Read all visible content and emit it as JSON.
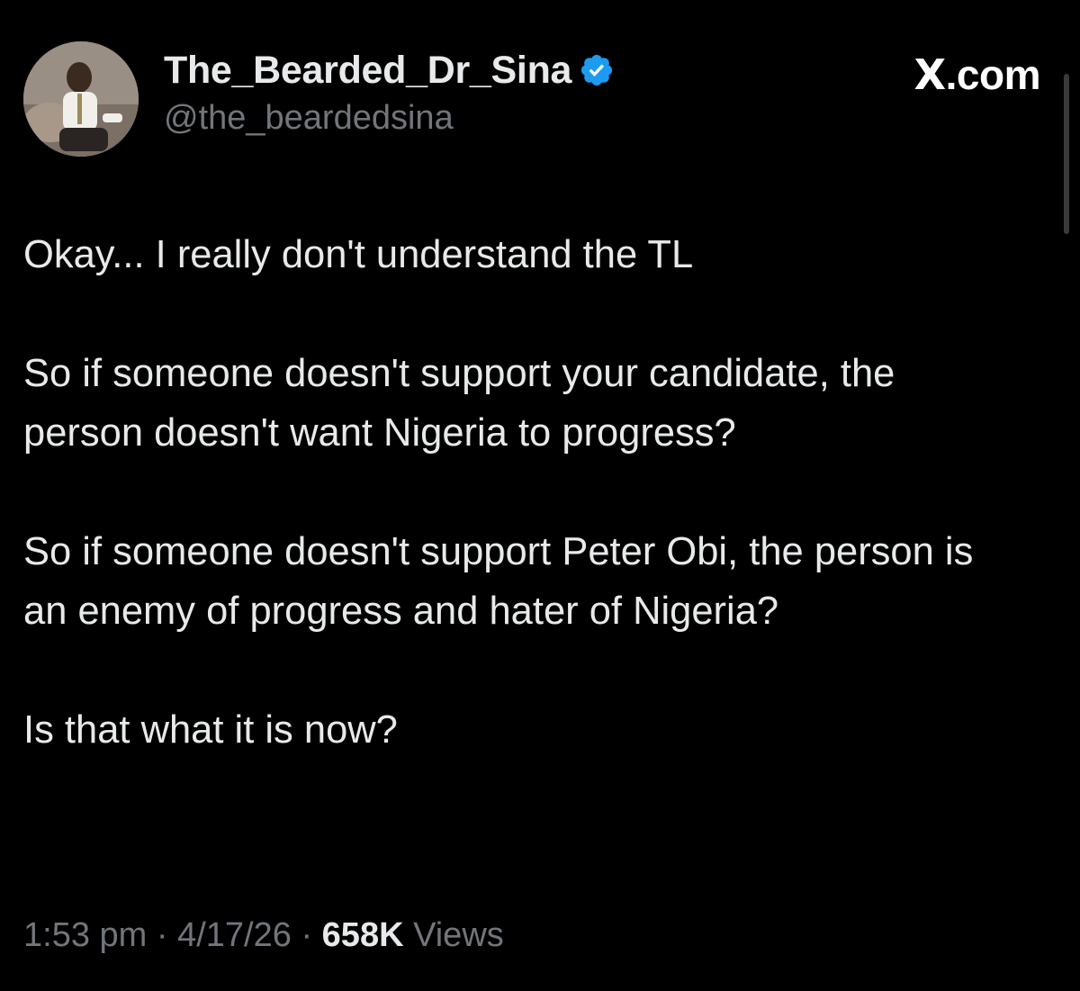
{
  "author": {
    "display_name": "The_Bearded_Dr_Sina",
    "handle": "@the_beardedsina",
    "verified_icon": "verified-badge-icon",
    "verified_color": "#1d9bf0"
  },
  "brand": {
    "label": ".com",
    "logo": "X"
  },
  "tweet": {
    "paragraphs": [
      "Okay... I really don't understand the TL",
      "So if someone doesn't support your candidate, the person doesn't want Nigeria to progress?",
      "So if someone doesn't support Peter Obi, the person is an enemy of progress and hater of Nigeria?",
      "Is that what it is now?"
    ]
  },
  "meta": {
    "time": "1:53 pm",
    "date": "4/17/26",
    "separator": "·",
    "views_count": "658K",
    "views_label": "Views"
  },
  "colors": {
    "background": "#000000",
    "text_primary": "#e7e9ea",
    "text_secondary": "#71767b"
  }
}
